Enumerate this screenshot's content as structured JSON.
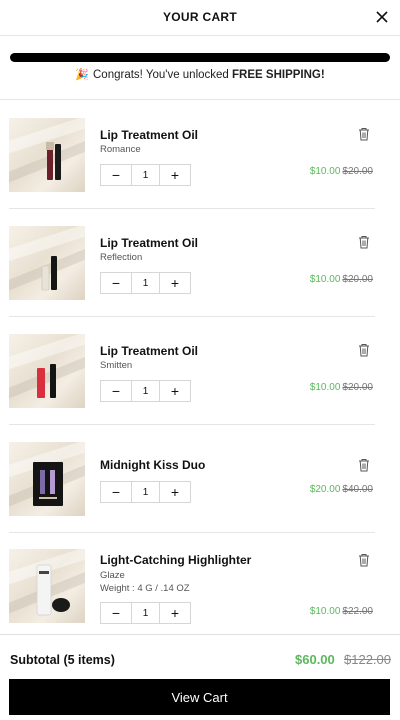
{
  "header": {
    "title": "YOUR CART"
  },
  "shipping": {
    "prefix": "Congrats! You've unlocked ",
    "bold": "FREE SHIPPING!",
    "progress": 1.0
  },
  "items": [
    {
      "name": "Lip Treatment Oil",
      "variant": "Romance",
      "weight": "",
      "qty": "1",
      "sale": "$10.00",
      "orig": "$20.00"
    },
    {
      "name": "Lip Treatment Oil",
      "variant": "Reflection",
      "weight": "",
      "qty": "1",
      "sale": "$10.00",
      "orig": "$20.00"
    },
    {
      "name": "Lip Treatment Oil",
      "variant": "Smitten",
      "weight": "",
      "qty": "1",
      "sale": "$10.00",
      "orig": "$20.00"
    },
    {
      "name": "Midnight Kiss Duo",
      "variant": "",
      "weight": "",
      "qty": "1",
      "sale": "$20.00",
      "orig": "$40.00"
    },
    {
      "name": "Light-Catching Highlighter",
      "variant": "Glaze",
      "weight": "Weight : 4 G / .14 OZ",
      "qty": "1",
      "sale": "$10.00",
      "orig": "$22.00"
    }
  ],
  "qty_minus": "−",
  "qty_plus": "+",
  "footer": {
    "subtotal_label": "Subtotal (5 items)",
    "subtotal_sale": "$60.00",
    "subtotal_orig": "$122.00",
    "view_cart": "View Cart"
  },
  "colors": {
    "sale": "#5cb85c",
    "button": "#000000",
    "progress": "#000000"
  }
}
